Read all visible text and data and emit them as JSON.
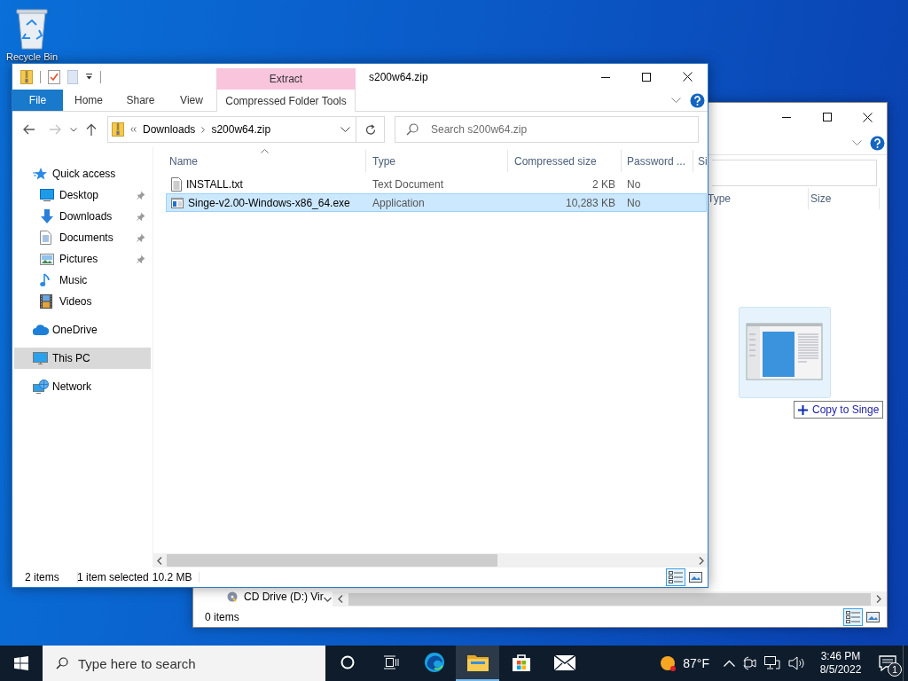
{
  "desktop_icons": [
    {
      "label": "Recycle Bin"
    }
  ],
  "back_window": {
    "columns": [
      "Type",
      "Size"
    ],
    "nav_items": [
      {
        "label": "CD Drive (D:) Vir"
      }
    ],
    "status": "0 items",
    "views": [
      {
        "kind": "details",
        "selected": true
      },
      {
        "kind": "tiles",
        "selected": false
      }
    ]
  },
  "window": {
    "title": "s200w64.zip",
    "context_tab": "Extract",
    "ribbon_tabs": [
      {
        "label": "File",
        "kind": "file"
      },
      {
        "label": "Home",
        "kind": "plain"
      },
      {
        "label": "Share",
        "kind": "plain"
      },
      {
        "label": "View",
        "kind": "plain"
      },
      {
        "label": "Compressed Folder Tools",
        "kind": "context"
      }
    ],
    "breadcrumb": [
      "Downloads",
      "s200w64.zip"
    ],
    "search": {
      "placeholder": "Search s200w64.zip"
    },
    "navigation": [
      {
        "label": "Quick access",
        "kind": "star",
        "selected": false,
        "children": [
          {
            "label": "Desktop",
            "kind": "desktop",
            "pinned": true,
            "selected": false
          },
          {
            "label": "Downloads",
            "kind": "downloads",
            "pinned": true,
            "selected": false
          },
          {
            "label": "Documents",
            "kind": "documents",
            "pinned": true,
            "selected": false
          },
          {
            "label": "Pictures",
            "kind": "pictures",
            "pinned": true,
            "selected": false
          },
          {
            "label": "Music",
            "kind": "music",
            "pinned": false,
            "selected": false
          },
          {
            "label": "Videos",
            "kind": "videos",
            "pinned": false,
            "selected": false
          }
        ]
      },
      {
        "label": "OneDrive",
        "kind": "cloud",
        "selected": false
      },
      {
        "label": "This PC",
        "kind": "pc",
        "selected": true
      },
      {
        "label": "Network",
        "kind": "network",
        "selected": false
      }
    ],
    "columns": [
      {
        "label": "Name",
        "sorted": true
      },
      {
        "label": "Type"
      },
      {
        "label": "Compressed size"
      },
      {
        "label": "Password ..."
      },
      {
        "label": "Si"
      }
    ],
    "rows": [
      {
        "kind": "text",
        "name": "INSTALL.txt",
        "type": "Text Document",
        "compressed_size": "2 KB",
        "password": "No",
        "selected": false
      },
      {
        "kind": "application",
        "name": "Singe-v2.00-Windows-x86_64.exe",
        "type": "Application",
        "compressed_size": "10,283 KB",
        "password": "No",
        "selected": true
      }
    ],
    "status": {
      "item_count": "2 items",
      "selection": "1 item selected",
      "selection_size": "10.2 MB"
    },
    "views": [
      {
        "kind": "details",
        "selected": true
      },
      {
        "kind": "tiles",
        "selected": false
      }
    ]
  },
  "drag": {
    "tooltip": "Copy to Singe"
  },
  "taskbar": {
    "search_placeholder": "Type here to search",
    "apps": [
      {
        "kind": "cortana",
        "active": false
      },
      {
        "kind": "taskview",
        "active": false
      },
      {
        "kind": "edge",
        "active": false
      },
      {
        "kind": "explorer",
        "active": true
      },
      {
        "kind": "store",
        "active": false
      },
      {
        "kind": "mail",
        "active": false
      }
    ],
    "weather": "87°F",
    "time": "3:46 PM",
    "date": "8/5/2022",
    "notifications": "1"
  }
}
